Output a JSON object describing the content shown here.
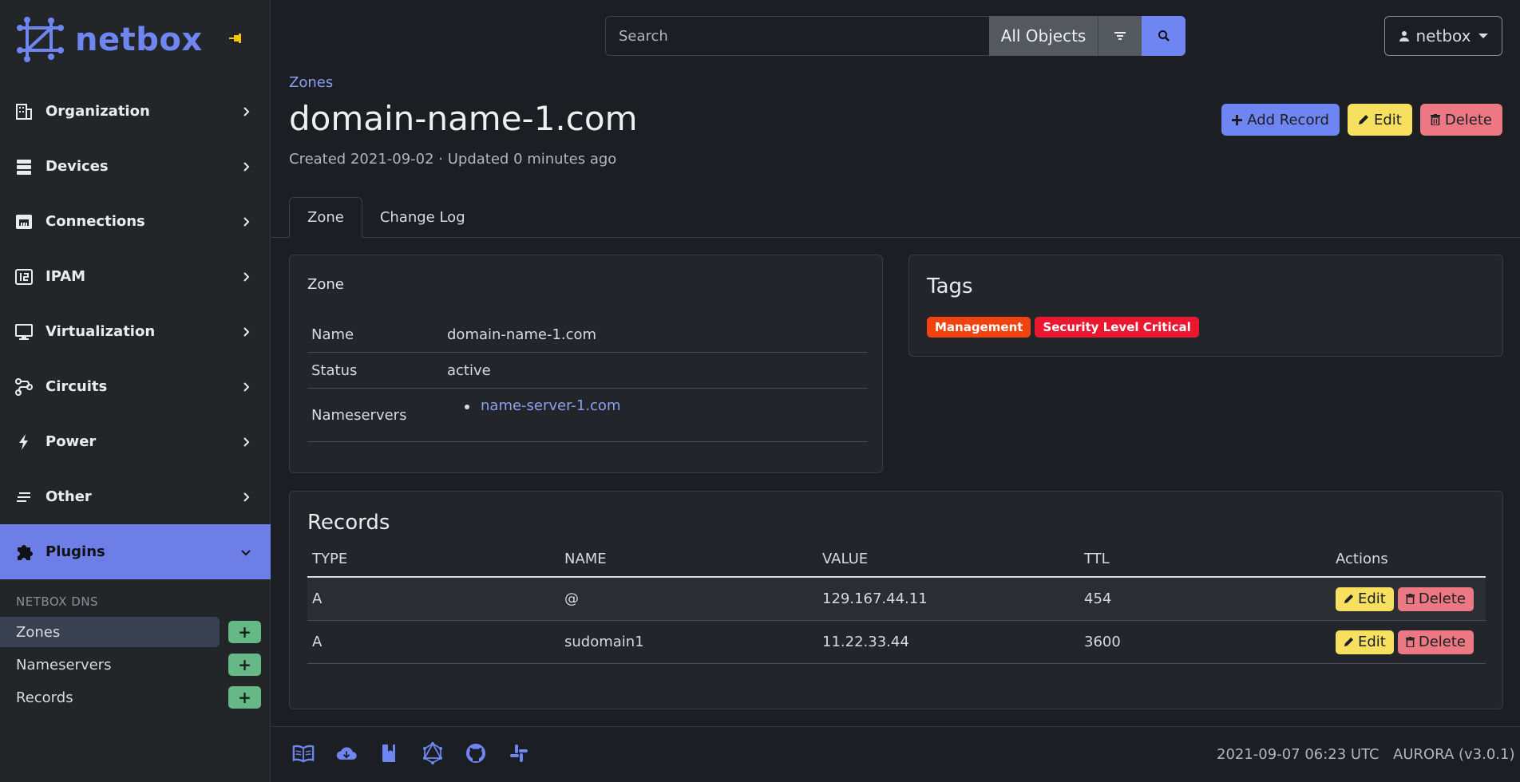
{
  "brand": {
    "name": "netbox"
  },
  "nav": {
    "items": [
      {
        "label": "Organization"
      },
      {
        "label": "Devices"
      },
      {
        "label": "Connections"
      },
      {
        "label": "IPAM"
      },
      {
        "label": "Virtualization"
      },
      {
        "label": "Circuits"
      },
      {
        "label": "Power"
      },
      {
        "label": "Other"
      },
      {
        "label": "Plugins"
      }
    ],
    "section_title": "NETBOX DNS",
    "sub_items": [
      {
        "label": "Zones",
        "add": "+"
      },
      {
        "label": "Nameservers",
        "add": "+"
      },
      {
        "label": "Records",
        "add": "+"
      }
    ]
  },
  "search": {
    "placeholder": "Search",
    "scope": "All Objects"
  },
  "user": {
    "name": "netbox"
  },
  "header": {
    "breadcrumb": "Zones",
    "title": "domain-name-1.com",
    "meta": "Created 2021-09-02 · Updated 0 minutes ago",
    "buttons": {
      "add": "Add Record",
      "edit": "Edit",
      "delete": "Delete"
    }
  },
  "tabs": [
    {
      "label": "Zone"
    },
    {
      "label": "Change Log"
    }
  ],
  "zone": {
    "title": "Zone",
    "fields": {
      "name_label": "Name",
      "name_value": "domain-name-1.com",
      "status_label": "Status",
      "status_value": "active",
      "ns_label": "Nameservers",
      "ns_values": [
        "name-server-1.com"
      ]
    }
  },
  "tags": {
    "title": "Tags",
    "items": [
      {
        "label": "Management",
        "color": "#f2420e"
      },
      {
        "label": "Security Level Critical",
        "color": "#eb1730"
      }
    ]
  },
  "records": {
    "title": "Records",
    "columns": [
      "TYPE",
      "NAME",
      "VALUE",
      "TTL",
      "Actions"
    ],
    "rows": [
      {
        "type": "A",
        "name": "@",
        "value": "129.167.44.11",
        "ttl": "454",
        "edit": "Edit",
        "delete": "Delete"
      },
      {
        "type": "A",
        "name": "sudomain1",
        "value": "11.22.33.44",
        "ttl": "3600",
        "edit": "Edit",
        "delete": "Delete"
      }
    ]
  },
  "footer": {
    "icons": [
      "docs-icon",
      "cloud-download-icon",
      "book-icon",
      "graphql-icon",
      "github-icon",
      "slack-icon"
    ],
    "datetime": "2021-09-07 06:23 UTC",
    "version": "AURORA (v3.0.1)"
  },
  "colors": {
    "primary": "#6e85f2",
    "warning": "#f7df60",
    "danger": "#ec7883",
    "success": "#66b886"
  }
}
